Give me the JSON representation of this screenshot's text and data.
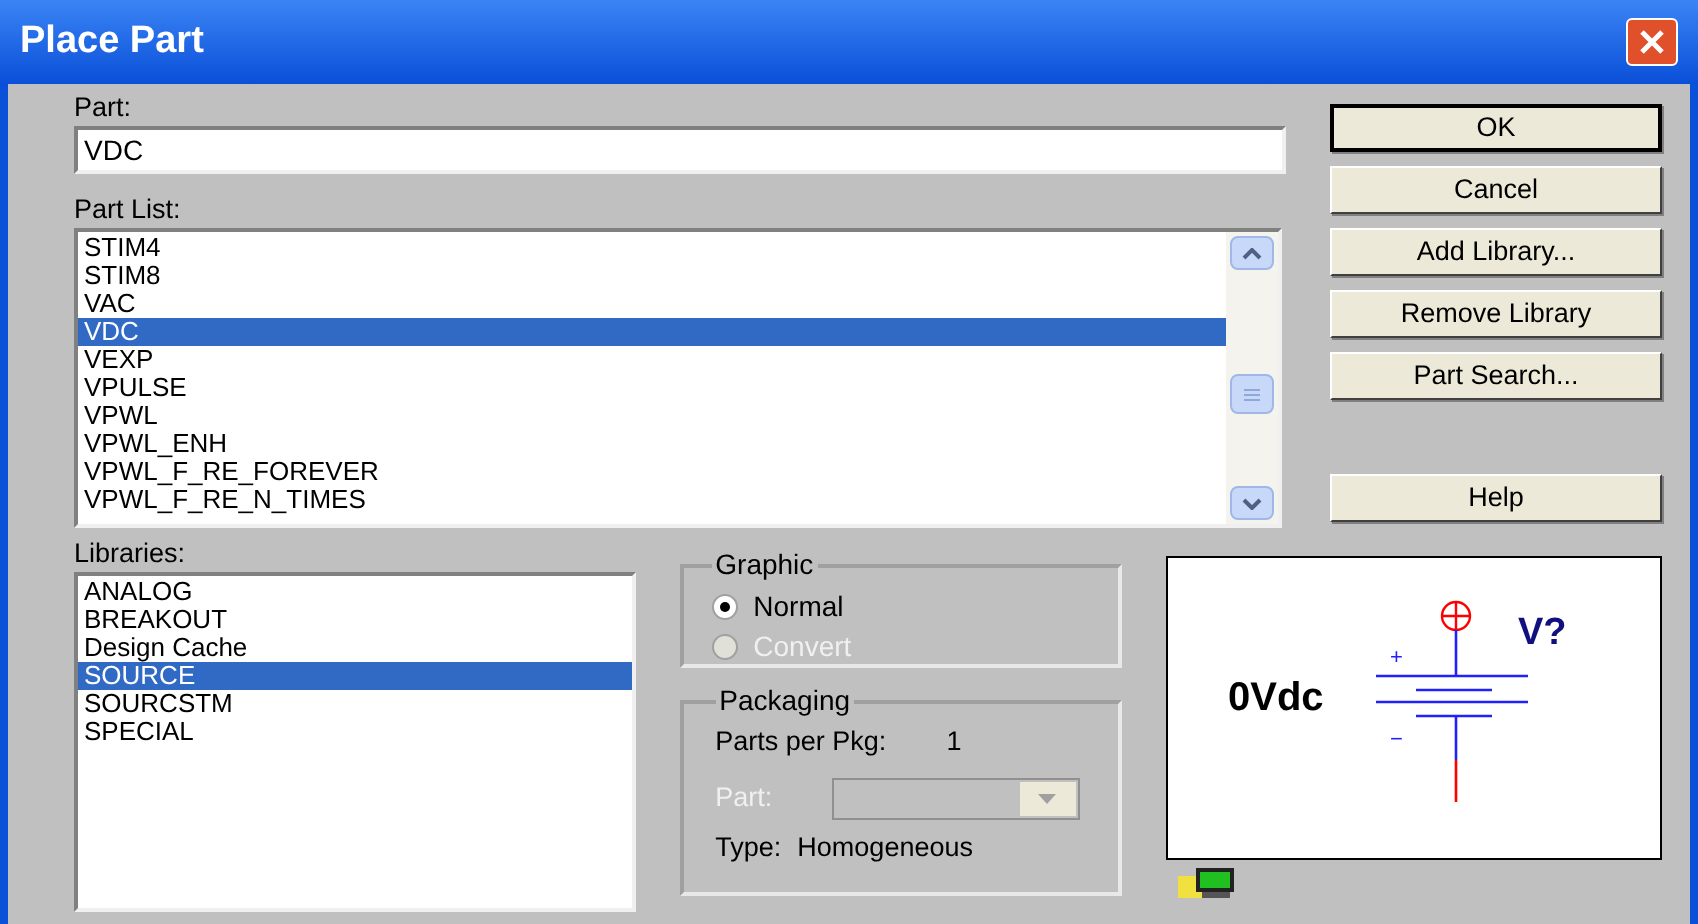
{
  "window": {
    "title": "Place Part"
  },
  "part": {
    "label": "Part:",
    "value": "VDC"
  },
  "part_list": {
    "label": "Part List:",
    "items": [
      {
        "text": "STIM4",
        "selected": false
      },
      {
        "text": "STIM8",
        "selected": false
      },
      {
        "text": "VAC",
        "selected": false
      },
      {
        "text": "VDC",
        "selected": true
      },
      {
        "text": "VEXP",
        "selected": false
      },
      {
        "text": "VPULSE",
        "selected": false
      },
      {
        "text": "VPWL",
        "selected": false
      },
      {
        "text": "VPWL_ENH",
        "selected": false
      },
      {
        "text": "VPWL_F_RE_FOREVER",
        "selected": false
      },
      {
        "text": "VPWL_F_RE_N_TIMES",
        "selected": false
      }
    ]
  },
  "buttons": [
    {
      "label": "OK",
      "default": true
    },
    {
      "label": "Cancel",
      "default": false
    },
    {
      "label": "Add Library...",
      "default": false
    },
    {
      "label": "Remove Library",
      "default": false
    },
    {
      "label": "Part Search...",
      "default": false
    }
  ],
  "help_button": {
    "label": "Help"
  },
  "libraries": {
    "label": "Libraries:",
    "items": [
      {
        "text": "ANALOG",
        "selected": false
      },
      {
        "text": "BREAKOUT",
        "selected": false
      },
      {
        "text": "Design Cache",
        "selected": false
      },
      {
        "text": "SOURCE",
        "selected": true
      },
      {
        "text": "SOURCSTM",
        "selected": false
      },
      {
        "text": "SPECIAL",
        "selected": false
      }
    ]
  },
  "graphic": {
    "title": "Graphic",
    "options": [
      {
        "label": "Normal",
        "selected": true,
        "disabled": false
      },
      {
        "label": "Convert",
        "selected": false,
        "disabled": true
      }
    ]
  },
  "packaging": {
    "title": "Packaging",
    "parts_per_pkg_label": "Parts per Pkg:",
    "parts_per_pkg": "1",
    "part_label": "Part:",
    "part_disabled": true,
    "type_label": "Type:",
    "type": "Homogeneous"
  },
  "preview": {
    "value": "0Vdc",
    "ref": "V?",
    "plus": "+",
    "minus": "−"
  }
}
